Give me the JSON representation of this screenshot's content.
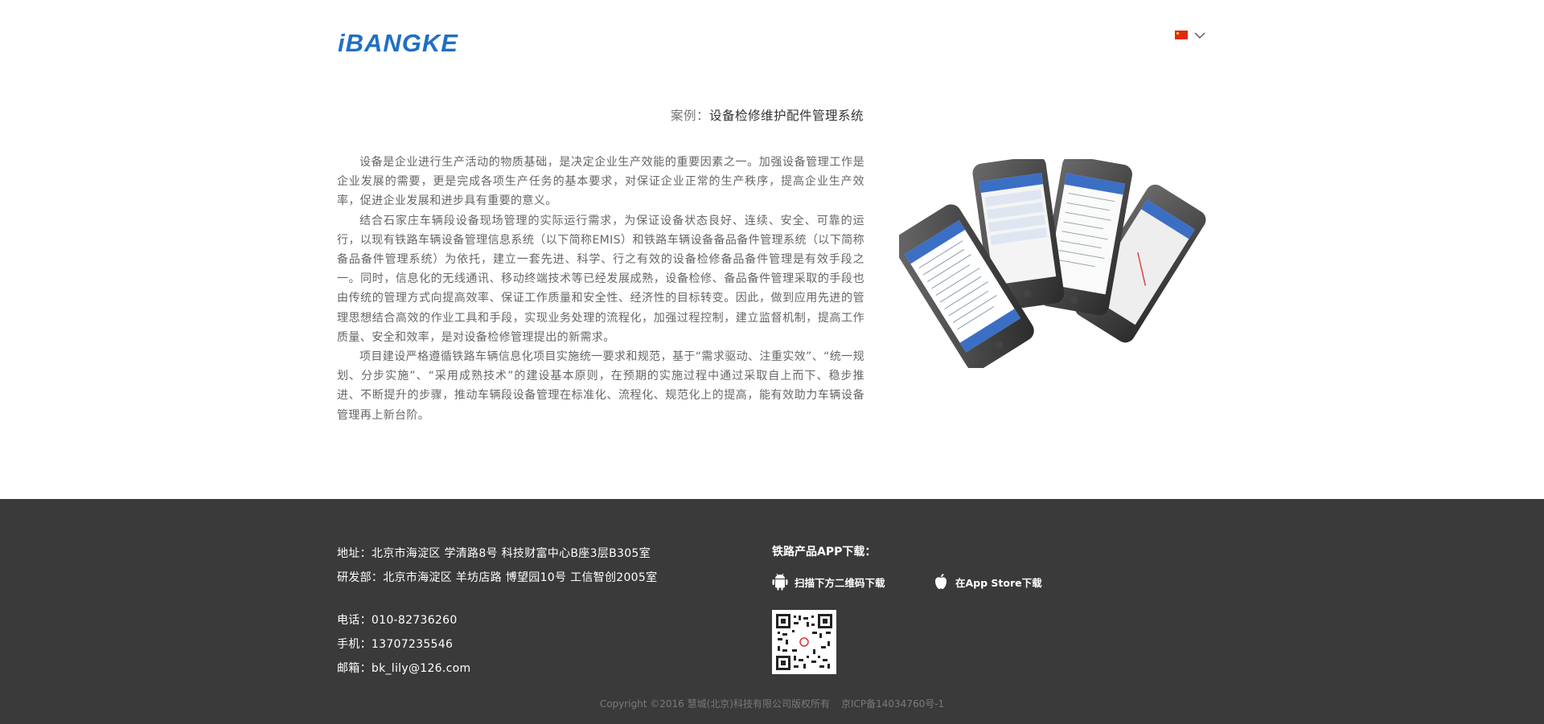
{
  "header": {
    "logo_text": "iBANGKE",
    "language_icon": "china-flag-icon",
    "dropdown_icon": "chevron-down-icon"
  },
  "case": {
    "prefix": "案例：",
    "title": "设备检修维护配件管理系统"
  },
  "article": {
    "paragraphs": [
      "设备是企业进行生产活动的物质基础，是决定企业生产效能的重要因素之一。加强设备管理工作是企业发展的需要，更是完成各项生产任务的基本要求，对保证企业正常的生产秩序，提高企业生产效率，促进企业发展和进步具有重要的意义。",
      "结合石家庄车辆段设备现场管理的实际运行需求，为保证设备状态良好、连续、安全、可靠的运行，以现有铁路车辆设备管理信息系统（以下简称EMIS）和铁路车辆设备备品备件管理系统（以下简称备品备件管理系统）为依托，建立一套先进、科学、行之有效的设备检修备品备件管理是有效手段之一。同时，信息化的无线通讯、移动终端技术等已经发展成熟，设备检修、备品备件管理采取的手段也由传统的管理方式向提高效率、保证工作质量和安全性、经济性的目标转变。因此，做到应用先进的管理思想结合高效的作业工具和手段，实现业务处理的流程化，加强过程控制，建立监督机制，提高工作质量、安全和效率，是对设备检修管理提出的新需求。",
      "项目建设严格遵循铁路车辆信息化项目实施统一要求和规范，基于“需求驱动、注重实效”、“统一规划、分步实施”、“采用成熟技术”的建设基本原则，在预期的实施过程中通过采取自上而下、稳步推进、不断提升的步骤，推动车辆段设备管理在标准化、流程化、规范化上的提高，能有效助力车辆设备管理再上新台阶。"
    ]
  },
  "footer": {
    "address": "地址：北京市海淀区 学清路8号 科技财富中心B座3层B305室",
    "rnd": "研发部：北京市海淀区 羊坊店路 博望园10号 工信智创2005室",
    "phone": "电话：010-82736260",
    "mobile": "手机：13707235546",
    "email": "邮箱：bk_lily@126.com",
    "app_title": "铁路产品APP下载：",
    "android_label": "扫描下方二维码下载",
    "android_icon": "android-icon",
    "ios_label": "在App Store下载",
    "ios_icon": "apple-icon",
    "qr_icon": "qr-code",
    "copyright": "Copyright ©2016 慧城(北京)科技有限公司版权所有",
    "icp": "京ICP备14034760号-1"
  }
}
